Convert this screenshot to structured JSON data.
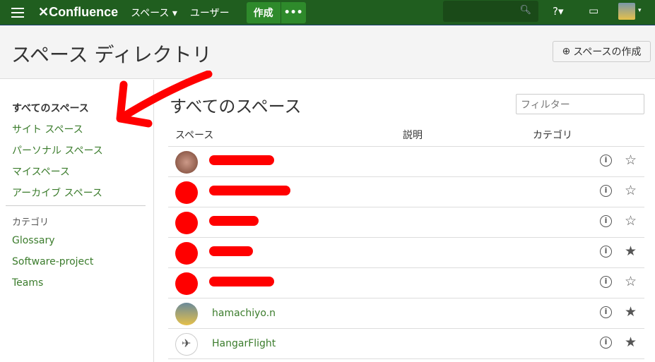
{
  "topbar": {
    "logo": "Confluence",
    "nav_spaces": "スペース ▾",
    "nav_users": "ユーザー",
    "create": "作成",
    "more": "•••",
    "help": "?▾",
    "avatar_caret": "▾"
  },
  "header": {
    "title": "スペース ディレクトリ",
    "create_space": "スペースの作成"
  },
  "sidebar": {
    "items": [
      "すべてのスペース",
      "サイト スペース",
      "パーソナル スペース",
      "マイスペース",
      "アーカイブ スペース"
    ],
    "category_heading": "カテゴリ",
    "categories": [
      "Glossary",
      "Software-project",
      "Teams"
    ]
  },
  "main": {
    "title": "すべてのスペース",
    "filter_placeholder": "フィルター",
    "columns": [
      "スペース",
      "説明",
      "カテゴリ"
    ],
    "rows": [
      {
        "name": "",
        "starred": false
      },
      {
        "name": "",
        "starred": false
      },
      {
        "name": "",
        "starred": false
      },
      {
        "name": "",
        "starred": true
      },
      {
        "name": "",
        "starred": false
      },
      {
        "name": "hamachiyo.n",
        "starred": true
      },
      {
        "name": "HangarFlight",
        "starred": true
      }
    ]
  },
  "colors": {
    "brand": "#205e1f",
    "link": "#3b7c2c",
    "redaction": "#ff0000"
  }
}
